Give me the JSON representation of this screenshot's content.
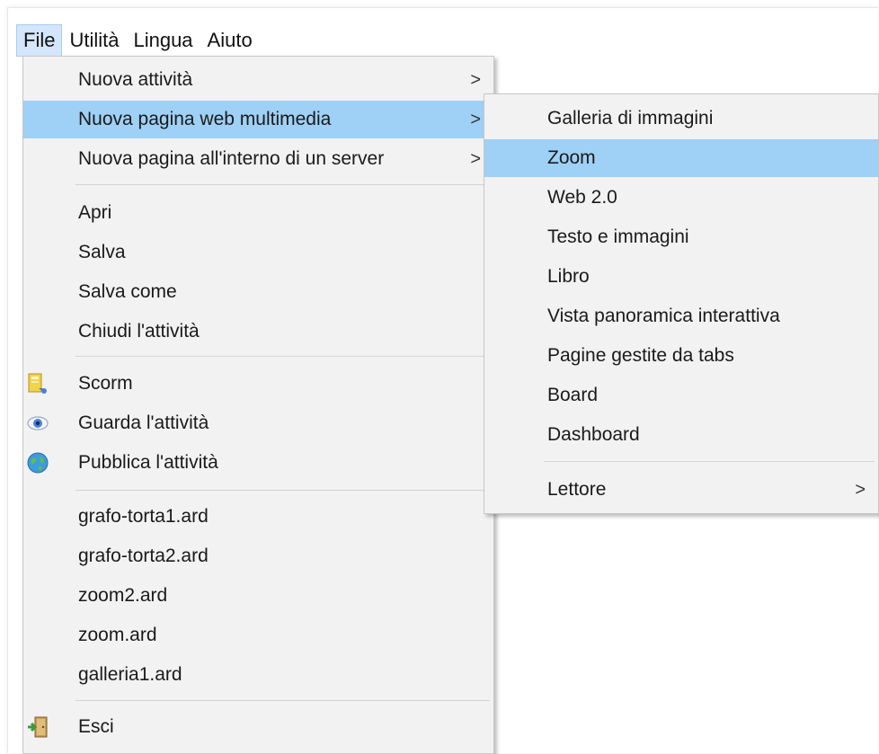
{
  "menubar": {
    "file": "File",
    "utilita": "Utilità",
    "lingua": "Lingua",
    "aiuto": "Aiuto"
  },
  "file_menu": {
    "nuova_attivita": "Nuova attività",
    "nuova_pagina_web": "Nuova pagina web multimedia",
    "nuova_pagina_server": "Nuova pagina all'interno di un server",
    "apri": "Apri",
    "salva": "Salva",
    "salva_come": "Salva come",
    "chiudi": "Chiudi l'attività",
    "scorm": "Scorm",
    "guarda": "Guarda l'attività",
    "pubblica": "Pubblica l'attività",
    "recent": [
      "grafo-torta1.ard",
      "grafo-torta2.ard",
      "zoom2.ard",
      "zoom.ard",
      "galleria1.ard"
    ],
    "esci": "Esci",
    "submenu_arrow": ">"
  },
  "submenu": {
    "galleria": "Galleria di immagini",
    "zoom": "Zoom",
    "web20": "Web 2.0",
    "testo_immagini": "Testo e immagini",
    "libro": "Libro",
    "vista_panoramica": "Vista panoramica interattiva",
    "pagine_tabs": "Pagine gestite da tabs",
    "board": "Board",
    "dashboard": "Dashboard",
    "lettore": "Lettore"
  },
  "icons": {
    "scorm": "scorm-package-icon",
    "guarda": "eye-icon",
    "pubblica": "globe-icon",
    "esci": "exit-door-icon"
  },
  "colors": {
    "highlight": "#9fd0f5",
    "menubar_open": "#d4e6fb",
    "menu_bg": "#f2f2f2"
  }
}
